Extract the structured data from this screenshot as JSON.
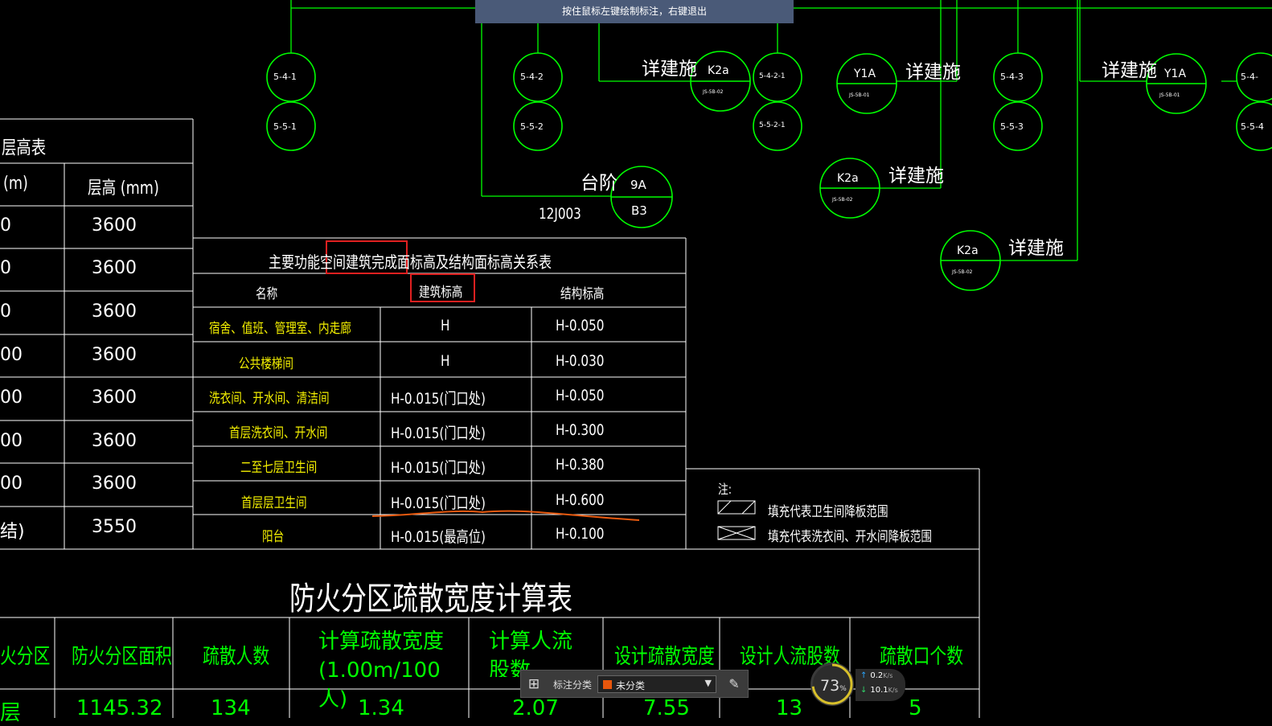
{
  "prompt_banner": "按住鼠标左键绘制标注，右键退出",
  "details": {
    "circles": [
      {
        "text": "5-4-1"
      },
      {
        "text": "5-5-1"
      },
      {
        "text": "5-4-2"
      },
      {
        "text": "5-5-2"
      },
      {
        "text": "5-4-2-1"
      },
      {
        "text": "5-5-2-1"
      },
      {
        "text": "5-4-3"
      },
      {
        "text": "5-5-3"
      },
      {
        "text": "5-4-"
      },
      {
        "text": "5-5-4"
      }
    ],
    "tags": [
      {
        "top": "K2a",
        "bottom": "JS-5B-02"
      },
      {
        "top": "Y1A",
        "bottom": "JS-5B-01"
      },
      {
        "top": "Y1A",
        "bottom": "JS-5B-01"
      },
      {
        "top": "K2a",
        "bottom": "JS-5B-02"
      },
      {
        "top": "K2a",
        "bottom": "JS-5B-02"
      }
    ],
    "detail_ref": "详建施",
    "step_label": "台阶",
    "step_ref": {
      "top": "9A",
      "bottom": "B3"
    },
    "atlas_code": "12J003"
  },
  "height_table": {
    "title": "层高表",
    "col1_header": "(m)",
    "col2_header": "层高  (mm)",
    "col1_cells": [
      "0",
      "0",
      "0",
      "00",
      "00",
      "00",
      "00",
      "结)"
    ],
    "col2_cells": [
      "3600",
      "3600",
      "3600",
      "3600",
      "3600",
      "3600",
      "3600",
      "3550"
    ]
  },
  "elevation_table": {
    "title": "主要功能空间建筑完成面标高及结构面标高关系表",
    "headers": [
      "名称",
      "建筑标高",
      "结构标高"
    ],
    "rows": [
      [
        "宿舍、值班、管理室、内走廊",
        "H",
        "H-0.050"
      ],
      [
        "公共楼梯间",
        "H",
        "H-0.030"
      ],
      [
        "洗衣间、开水间、清洁间",
        "H-0.015(门口处)",
        "H-0.050"
      ],
      [
        "首层洗衣间、开水间",
        "H-0.015(门口处)",
        "H-0.300"
      ],
      [
        "二至七层卫生间",
        "H-0.015(门口处)",
        "H-0.380"
      ],
      [
        "首层层卫生间",
        "H-0.015(门口处)",
        "H-0.600"
      ],
      [
        "阳台",
        "H-0.015(最高位)",
        "H-0.100"
      ]
    ]
  },
  "notes": {
    "title": "注:",
    "items": [
      "填充代表卫生间降板范围",
      "填充代表洗衣间、开水间降板范围"
    ]
  },
  "evac_table": {
    "title": "防火分区疏散宽度计算表",
    "headers": [
      "火分区",
      "防火分区面积",
      "疏散人数",
      "计算疏散宽度(1.00m/100人)",
      "计算人流股数(0.6m/股)",
      "设计疏散宽度",
      "设计人流股数",
      "疏散口个数"
    ],
    "partial_row": [
      "层",
      "1145.32",
      "134",
      "1.34",
      "2.07",
      "7.55",
      "13",
      "5"
    ]
  },
  "toolbar": {
    "label": "标注分类",
    "selected": "未分类",
    "swatch_color": "#e8560c"
  },
  "net_widget": {
    "percent": "73",
    "percent_unit": "%",
    "up": "0.2",
    "down": "10.1",
    "unit": "K/s"
  },
  "colors": {
    "lines": "#00ff00",
    "white": "#ffffff",
    "yellow": "#f4f000",
    "markup_red": "#e02020",
    "markup_orange": "#e85a10"
  }
}
